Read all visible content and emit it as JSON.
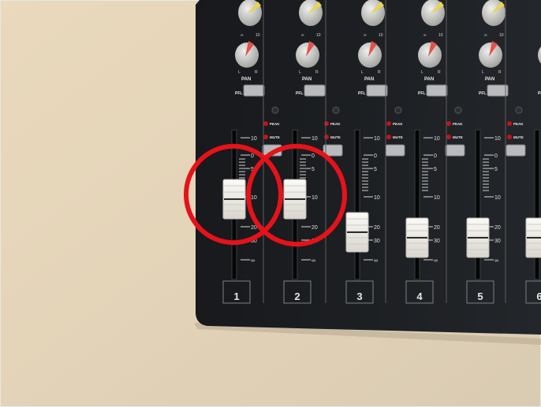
{
  "scene": {
    "description_type": "photo",
    "colors": {
      "table": "#e6d7bc",
      "mixer": "#1d1f22",
      "highlight": "#e6121a",
      "fader_cap": "#f1efe9",
      "led": "#c4141a",
      "knob_red": "#e2524a",
      "knob_yellow": "#e9d54a"
    }
  },
  "labels": {
    "pan": "PAN",
    "pfl": "PFL",
    "peak": "PEAK",
    "mute": "MUTE",
    "knob_l": "L",
    "knob_r": "R",
    "knob_min": "∞",
    "knob_max": "10",
    "scale": [
      "10",
      "0",
      "5",
      "10",
      "20",
      "30",
      "∞"
    ]
  },
  "channels": [
    {
      "number": "1",
      "fader_level": 0.55
    },
    {
      "number": "2",
      "fader_level": 0.55
    },
    {
      "number": "3",
      "fader_level": 0.25
    },
    {
      "number": "4",
      "fader_level": 0.2
    },
    {
      "number": "5",
      "fader_level": 0.2
    },
    {
      "number": "6",
      "fader_level": 0.2
    }
  ],
  "annotations": [
    {
      "shape": "circle",
      "target_channel": "1"
    },
    {
      "shape": "circle",
      "target_channel": "2"
    }
  ]
}
